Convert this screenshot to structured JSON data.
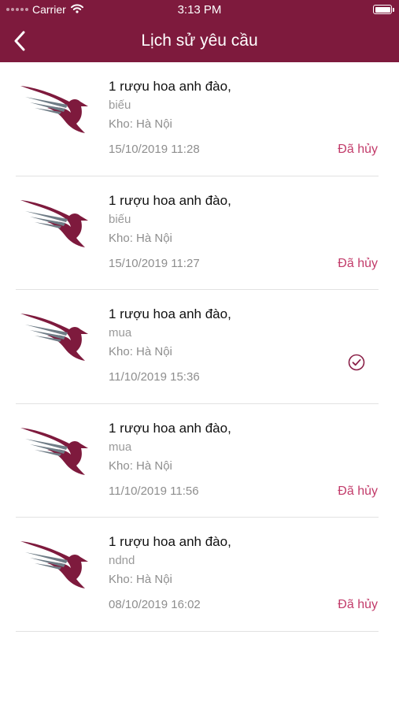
{
  "status_bar": {
    "carrier": "Carrier",
    "time": "3:13 PM"
  },
  "nav": {
    "title": "Lịch sử yêu cầu",
    "back_icon": "chevron-left-icon"
  },
  "colors": {
    "header": "#7e1a3d",
    "accent": "#c23b6a",
    "logo_primary": "#7e1a3d",
    "logo_secondary": "#6f7c86"
  },
  "requests": [
    {
      "title": "1 rượu hoa anh đào,",
      "type": "biếu",
      "warehouse": "Kho: Hà Nội",
      "datetime": "15/10/2019 11:28",
      "status": "Đã hủy",
      "status_icon": ""
    },
    {
      "title": "1 rượu hoa anh đào,",
      "type": "biếu",
      "warehouse": "Kho: Hà Nội",
      "datetime": "15/10/2019 11:27",
      "status": "Đã hủy",
      "status_icon": ""
    },
    {
      "title": "1 rượu hoa anh đào,",
      "type": "mua",
      "warehouse": "Kho: Hà Nội",
      "datetime": "11/10/2019 15:36",
      "status": "",
      "status_icon": "check-circle-icon"
    },
    {
      "title": "1 rượu hoa anh đào,",
      "type": "mua",
      "warehouse": "Kho: Hà Nội",
      "datetime": "11/10/2019 11:56",
      "status": "Đã hủy",
      "status_icon": ""
    },
    {
      "title": "1 rượu hoa anh đào,",
      "type": "ndnd",
      "warehouse": "Kho: Hà Nội",
      "datetime": "08/10/2019 16:02",
      "status": "Đã hủy",
      "status_icon": ""
    }
  ]
}
